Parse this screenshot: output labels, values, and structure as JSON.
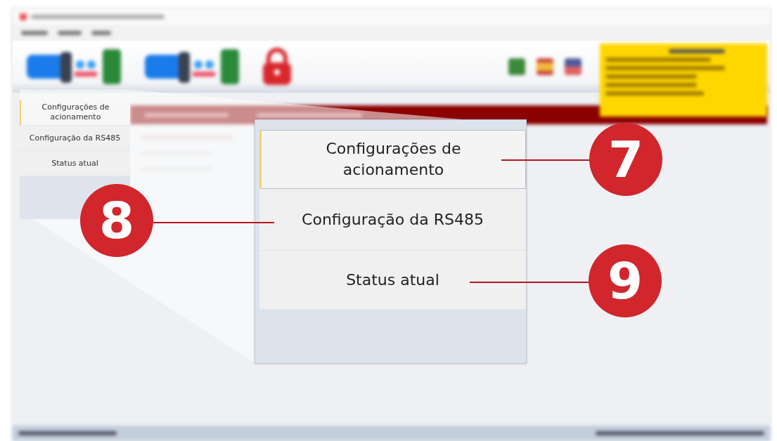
{
  "sidebar": {
    "tabs": [
      {
        "label": "Configurações de acionamento",
        "selected": true
      },
      {
        "label": "Configuração da RS485",
        "selected": false
      },
      {
        "label": "Status atual",
        "selected": false
      }
    ]
  },
  "zoom_callout": {
    "tabs": [
      {
        "label": "Configurações de acionamento",
        "selected": true
      },
      {
        "label": "Configuração da RS485",
        "selected": false
      },
      {
        "label": "Status atual",
        "selected": false
      }
    ]
  },
  "callouts": [
    {
      "number": "7"
    },
    {
      "number": "8"
    },
    {
      "number": "9"
    }
  ]
}
